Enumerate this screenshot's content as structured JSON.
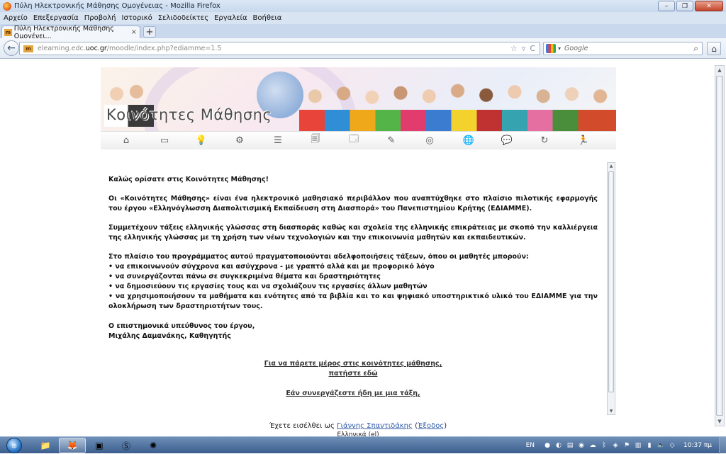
{
  "window": {
    "title": "Πύλη Ηλεκτρονικής Μάθησης Ομογένειας - Mozilla Firefox",
    "minimize": "–",
    "maximize": "❐",
    "close": "✕"
  },
  "menubar": {
    "items": [
      "Αρχείο",
      "Επεξεργασία",
      "Προβολή",
      "Ιστορικό",
      "Σελιδοδείκτες",
      "Εργαλεία",
      "Βοήθεια"
    ]
  },
  "tab": {
    "label": "Πύλη Ηλεκτρονικής Μάθησης Ομογένει...",
    "close": "×",
    "new_tab": "+"
  },
  "navbar": {
    "back": "←",
    "url_prefix": "elearning.edc.",
    "url_domain": "uoc.gr",
    "url_suffix": "/moodle/index.php?ediamme=1.5",
    "bookmark_star": "☆",
    "dropdown": "▿",
    "reload": "C",
    "search_placeholder": "Google",
    "search_dropdown": "▾",
    "search_button": "⌕",
    "home": "⌂"
  },
  "banner": {
    "title": "Κοινότητες Μάθησης",
    "nav_icons": [
      "home-icon",
      "news-icon",
      "lightbulb-icon",
      "gears-icon",
      "list-icon",
      "documents-icon",
      "browser-icon",
      "notes-icon",
      "lifebuoy-icon",
      "globe-icon",
      "chat-icon",
      "refresh-icon",
      "exit-icon"
    ],
    "nav_glyphs": [
      "⌂",
      "▭",
      "💡",
      "⚙",
      "☰",
      "🗐",
      "🗔",
      "✎",
      "◎",
      "🌐",
      "💬",
      "↻",
      "🏃"
    ]
  },
  "content": {
    "welcome": "Καλώς ορίσατε στις Κοινότητες Μάθησης!",
    "intro": "Οι «Κοινότητες Μάθησης» είναι ένα ηλεκτρονικό μαθησιακό περιβάλλον που αναπτύχθηκε στο πλαίσιο πιλοτικής εφαρμογής του έργου «Ελληνόγλωσση Διαπολιτισμική Εκπαίδευση στη Διασπορά» του Πανεπιστημίου Κρήτης (ΕΔΙΑΜΜΕ).",
    "participants": "Συμμετέχουν τάξεις ελληνικής γλώσσας στη διασποράς καθώς και σχολεία της ελληνικής επικράτειας με σκοπό την καλλιέργεια της ελληνικής γλώσσας με τη χρήση των νέων τεχνολογιών και την επικοινωνία μαθητών και εκπαιδευτικών.",
    "program_intro": "Στο πλαίσιο του προγράμματος αυτού πραγματοποιούνται αδελφοποιήσεις τάξεων, όπου οι μαθητές μπορούν:",
    "bullets": [
      "• να επικοινωνούν σύγχρονα και ασύγχρονα - με γραπτό αλλά και με προφορικό λόγο",
      "• να συνεργάζονται πάνω σε συγκεκριμένα θέματα και δραστηριότητες",
      "• να δημοσιεύουν τις εργασίες τους και να σχολιάζουν τις εργασίες άλλων μαθητών",
      "• να χρησιμοποιήσουν τα μαθήματα και ενότητες από τα βιβλία και το και ψηφιακό υποστηρικτικό υλικό του ΕΔΙΑΜΜΕ για την ολοκλήρωση των δραστηριοτήτων τους."
    ],
    "signature_line1": "Ο επιστημονικά υπεύθυνος του έργου,",
    "signature_line2": "Μιχάλης Δαμανάκης, Καθηγητής",
    "join_link_line1": "Για να πάρετε μέρος στις κοινότητες μάθησης,",
    "join_link_line2": "πατήστε εδώ",
    "existing_link": "Εάν συνεργάζεστε ήδη με μια τάξη,"
  },
  "footer": {
    "logged_in_prefix": "Έχετε εισέλθει ως",
    "user_name": "Γιάννης Σπαντιδάκης",
    "logout_open": "(",
    "logout": "Έξοδος",
    "logout_close": ")",
    "language": "Ελληνικά (el)"
  },
  "taskbar": {
    "start": "⊞",
    "apps": [
      "explorer",
      "firefox",
      "media",
      "skype",
      "other"
    ],
    "tray_lang": "EN",
    "clock": "10:37 πμ"
  },
  "colors": {
    "link": "#2f5aa8",
    "taskbar": "#3c5e8e",
    "titlebar": "#c7d9ee"
  }
}
